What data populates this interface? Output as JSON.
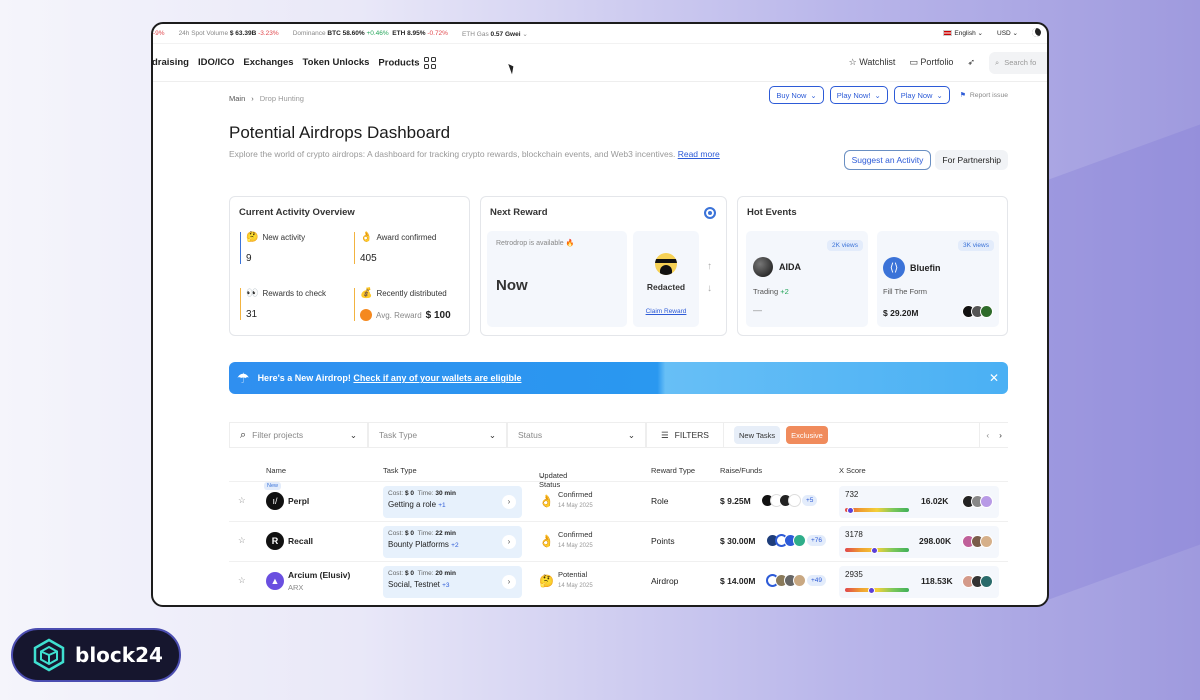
{
  "ticker": {
    "first_change": "-9%",
    "spot_volume_label": "24h Spot Volume",
    "spot_volume_value": "$ 63.39B",
    "spot_volume_change": "-3.23%",
    "dominance_label": "Dominance",
    "btc_label": "BTC",
    "btc_value": "58.60%",
    "btc_change": "+0.46%",
    "eth_label": "ETH",
    "eth_value": "8.95%",
    "eth_change": "-0.72%",
    "gas_label": "ETH Gas",
    "gas_value": "0.57 Gwei",
    "language": "English",
    "currency": "USD"
  },
  "nav": {
    "links": [
      "draising",
      "IDO/ICO",
      "Exchanges",
      "Token Unlocks",
      "Products"
    ],
    "watchlist": "Watchlist",
    "portfolio": "Portfolio",
    "search_placeholder": "Search fo"
  },
  "breadcrumb": {
    "home": "Main",
    "current": "Drop Hunting"
  },
  "top_actions": {
    "buy": "Buy Now",
    "play1": "Play Now!",
    "play2": "Play Now",
    "report": "Report issue"
  },
  "header": {
    "title": "Potential Airdrops Dashboard",
    "subtitle": "Explore the world of crypto airdrops: A dashboard for tracking crypto rewards, blockchain events, and Web3 incentives.",
    "read_more": "Read more",
    "suggest": "Suggest an Activity",
    "partnership": "For Partnership"
  },
  "overview": {
    "title": "Current Activity Overview",
    "new_activity_label": "New activity",
    "new_activity_value": "9",
    "award_confirmed_label": "Award confirmed",
    "award_confirmed_value": "405",
    "rewards_check_label": "Rewards to check",
    "rewards_check_value": "31",
    "recently_distributed_label": "Recently distributed",
    "avg_reward_label": "Avg. Reward",
    "avg_reward_value": "$ 100"
  },
  "next_reward": {
    "title": "Next Reward",
    "status": "Retrodrop is available 🔥",
    "when": "Now",
    "name": "Redacted",
    "claim": "Claim Reward"
  },
  "hot_events": {
    "title": "Hot Events",
    "items": [
      {
        "views": "2K views",
        "name": "AIDA",
        "sub": "Trading",
        "sub_extra": "+2",
        "value": "—"
      },
      {
        "views": "3K views",
        "name": "Bluefin",
        "sub": "Fill The Form",
        "sub_extra": "",
        "value": "$ 29.20M"
      }
    ]
  },
  "banner": {
    "lead": "Here's a New Airdrop!",
    "link": "Check if any of your wallets are eligible"
  },
  "filters": {
    "project_placeholder": "Filter projects",
    "task_type": "Task Type",
    "status": "Status",
    "filters_label": "FILTERS",
    "new_tasks": "New Tasks",
    "exclusive": "Exclusive"
  },
  "table": {
    "columns": [
      "Name",
      "Task Type",
      "Updated Status",
      "Reward Type",
      "Raise/Funds",
      "X Score"
    ],
    "rows": [
      {
        "badge": "New",
        "name": "Perpl",
        "ticker": "",
        "cost": "$ 0",
        "time": "30 min",
        "task": "Getting a role",
        "task_extra": "+1",
        "status": "Confirmed",
        "date": "14 May 2025",
        "reward": "Role",
        "raise": "$ 9.25M",
        "investors_more": "+5",
        "score": "732",
        "score_pct": 0.08,
        "followers": "16.02K"
      },
      {
        "badge": "",
        "name": "Recall",
        "ticker": "",
        "cost": "$ 0",
        "time": "22 min",
        "task": "Bounty Platforms",
        "task_extra": "+2",
        "status": "Confirmed",
        "date": "14 May 2025",
        "reward": "Points",
        "raise": "$ 30.00M",
        "investors_more": "+76",
        "score": "3178",
        "score_pct": 0.45,
        "followers": "298.00K"
      },
      {
        "badge": "",
        "name": "Arcium (Elusiv)",
        "ticker": "ARX",
        "cost": "$ 0",
        "time": "20 min",
        "task": "Social, Testnet",
        "task_extra": "+3",
        "status": "Potential",
        "date": "14 May 2025",
        "reward": "Airdrop",
        "raise": "$ 14.00M",
        "investors_more": "+49",
        "score": "2935",
        "score_pct": 0.4,
        "followers": "118.53K"
      }
    ],
    "cost_label": "Cost:",
    "time_label": "Time:"
  },
  "brand": {
    "logo_text": "block24",
    "accent": "#2d5bd7",
    "banner": "#2f8ff0"
  }
}
